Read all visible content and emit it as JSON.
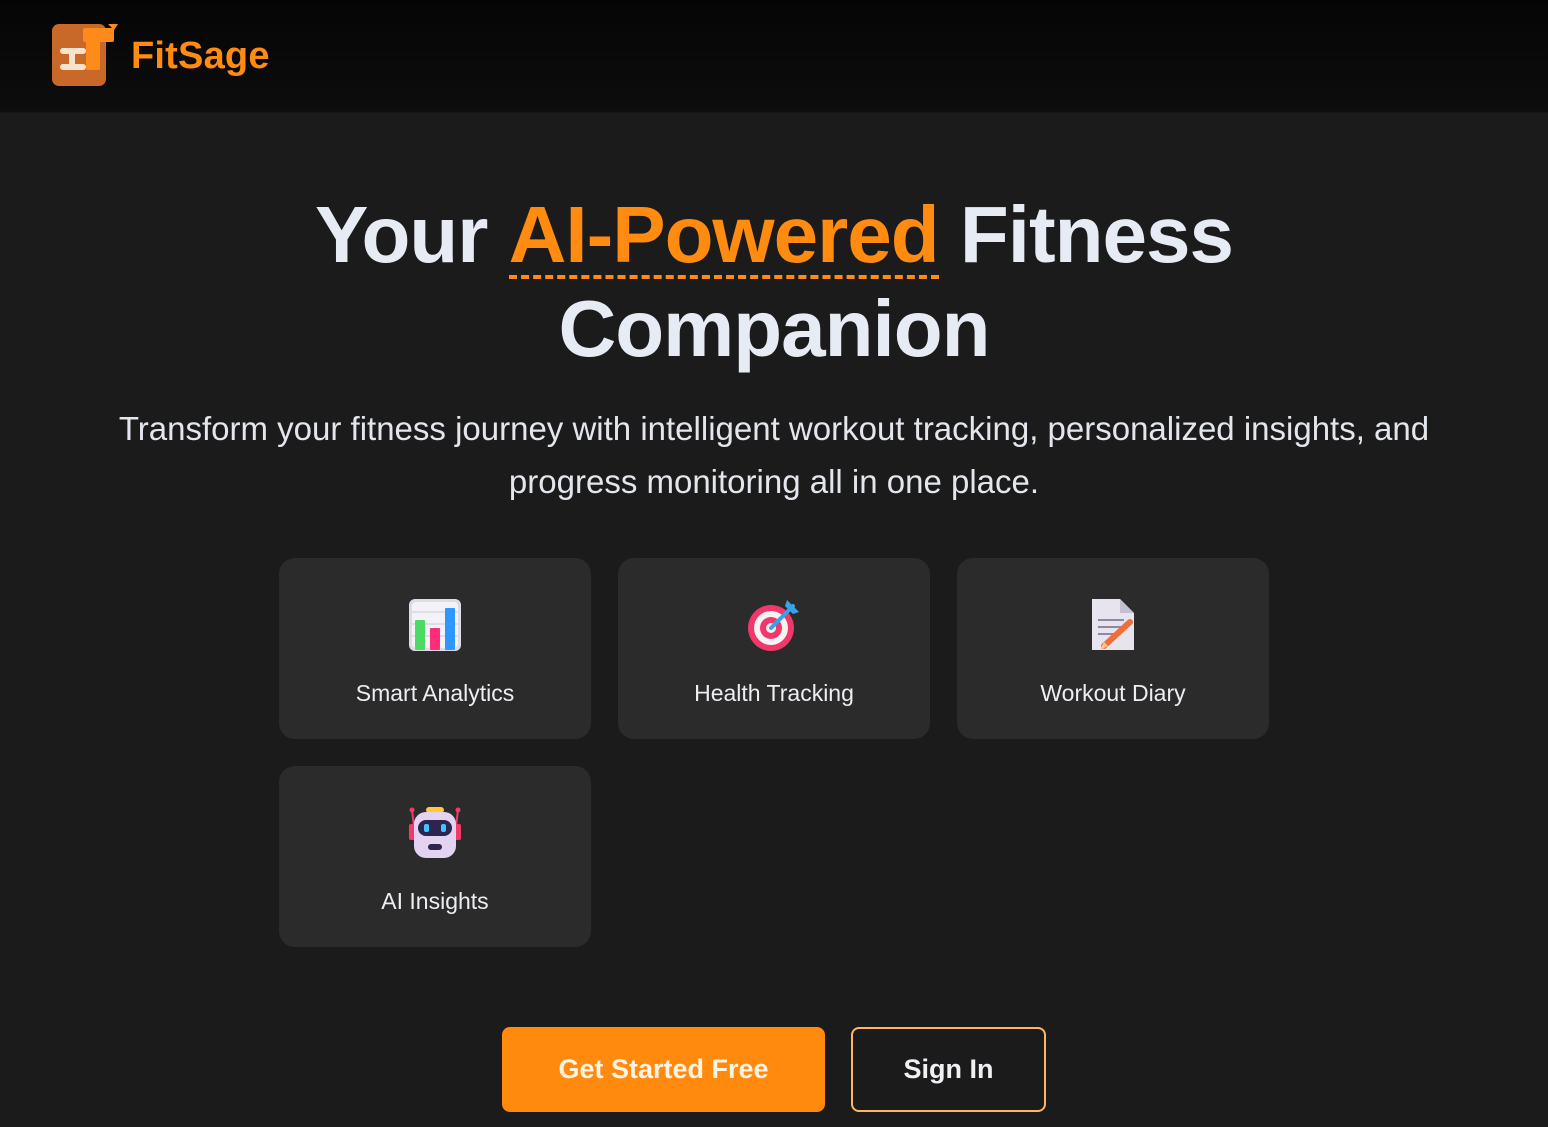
{
  "brand": {
    "name": "FitSage",
    "logo_icon": "dumbbell-logo-icon"
  },
  "hero": {
    "title_before": "Your",
    "title_accent": "AI-Powered",
    "title_after": "Fitness",
    "title_line2": "Companion",
    "subtitle": "Transform your fitness journey with intelligent workout tracking, personalized insights, and progress monitoring all in one place."
  },
  "features": [
    {
      "label": "Smart Analytics",
      "icon": "bar-chart-icon"
    },
    {
      "label": "Health Tracking",
      "icon": "target-icon"
    },
    {
      "label": "Workout Diary",
      "icon": "memo-icon"
    },
    {
      "label": "AI Insights",
      "icon": "robot-icon"
    }
  ],
  "actions": {
    "primary_label": "Get Started Free",
    "secondary_label": "Sign In"
  },
  "colors": {
    "accent": "#ff8c10",
    "background": "#1b1b1b",
    "card": "#2b2b2b",
    "header": "#0a0a0a"
  }
}
